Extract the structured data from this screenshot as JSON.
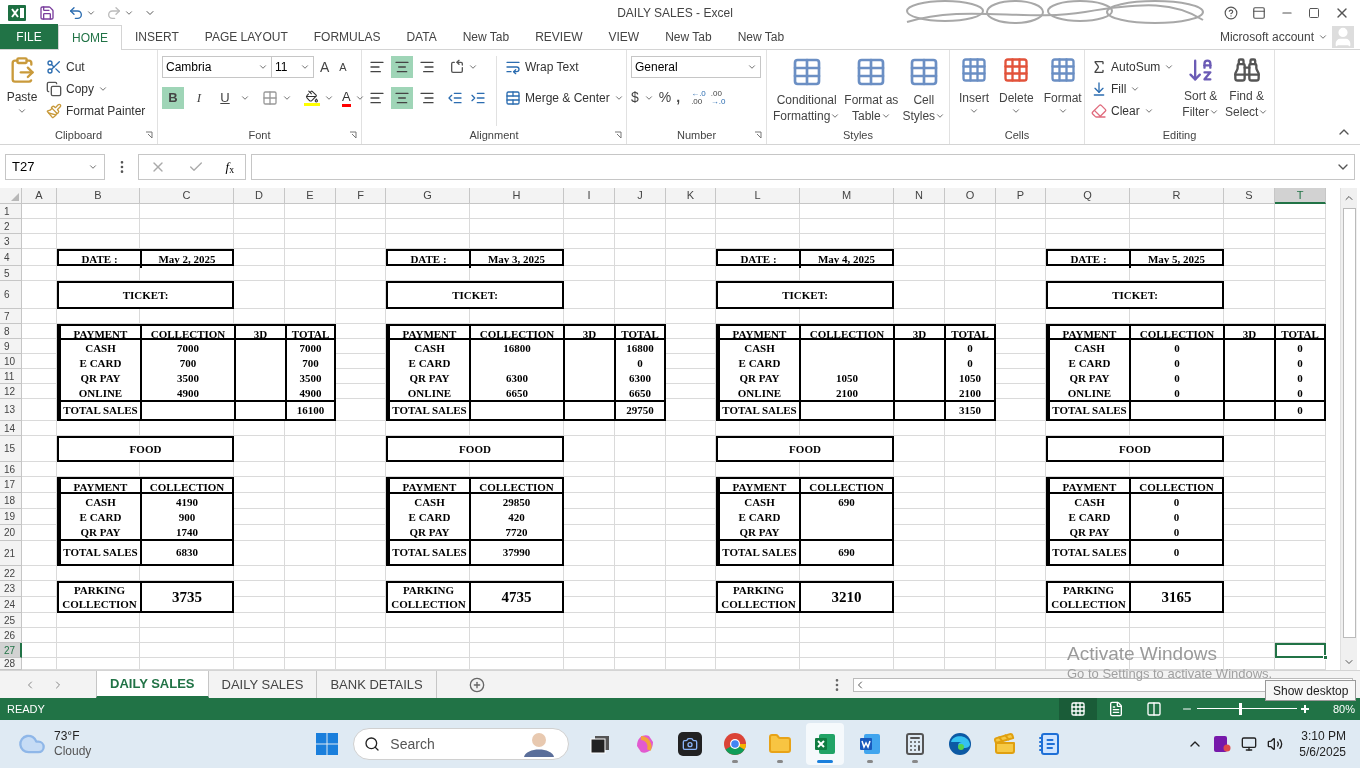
{
  "window": {
    "title": "DAILY SALES - Excel"
  },
  "ribbon_tabs": [
    {
      "label": "FILE",
      "kind": "file",
      "selected": false
    },
    {
      "label": "HOME",
      "kind": "tab",
      "selected": true
    },
    {
      "label": "INSERT",
      "kind": "tab",
      "selected": false
    },
    {
      "label": "PAGE LAYOUT",
      "kind": "tab",
      "selected": false
    },
    {
      "label": "FORMULAS",
      "kind": "tab",
      "selected": false
    },
    {
      "label": "DATA",
      "kind": "tab",
      "selected": false
    },
    {
      "label": "New Tab",
      "kind": "tab",
      "selected": false
    },
    {
      "label": "REVIEW",
      "kind": "tab",
      "selected": false
    },
    {
      "label": "VIEW",
      "kind": "tab",
      "selected": false
    },
    {
      "label": "New Tab",
      "kind": "tab",
      "selected": false
    },
    {
      "label": "New Tab",
      "kind": "tab",
      "selected": false
    }
  ],
  "account": "Microsoft account",
  "clipboard": {
    "paste": "Paste",
    "cut": "Cut",
    "copy": "Copy",
    "format_painter": "Format Painter",
    "label": "Clipboard"
  },
  "font": {
    "name": "Cambria",
    "size": "11",
    "grow": "A",
    "shrink": "A",
    "color_letter": "A",
    "label": "Font",
    "styles": [
      {
        "label": "B",
        "kind": "bold",
        "on": true
      },
      {
        "label": "I",
        "kind": "italic",
        "on": false
      },
      {
        "label": "U",
        "kind": "underline",
        "on": false
      }
    ]
  },
  "alignment": {
    "label": "Alignment",
    "wrap_text": "Wrap Text",
    "merge_center": "Merge & Center",
    "vertical": [
      {
        "kind": "top",
        "selected": false
      },
      {
        "kind": "middle",
        "selected": true
      },
      {
        "kind": "bottom",
        "selected": false
      }
    ],
    "horizontal": [
      {
        "kind": "left",
        "selected": false
      },
      {
        "kind": "center",
        "selected": true
      },
      {
        "kind": "right",
        "selected": false
      }
    ]
  },
  "number": {
    "format": "General",
    "currency": "$",
    "percent": "%",
    "comma": ",",
    "increase_decimal": [
      "←.0",
      ".00"
    ],
    "decrease_decimal": [
      ".00",
      "→.0"
    ],
    "label": "Number"
  },
  "styles": {
    "label": "Styles",
    "buttons": [
      [
        "Conditional",
        "Formatting"
      ],
      [
        "Format as",
        "Table"
      ],
      [
        "Cell",
        "Styles"
      ]
    ]
  },
  "cells": {
    "label": "Cells",
    "buttons": [
      "Insert",
      "Delete",
      "Format"
    ]
  },
  "editing": {
    "label": "Editing",
    "autosum": "AutoSum",
    "fill": "Fill",
    "clear": "Clear",
    "sort": [
      "Sort &",
      "Filter"
    ],
    "find": [
      "Find &",
      "Select"
    ]
  },
  "formula_bar": {
    "name_box": "T27",
    "function_label": "*f*$_{x}$"
  },
  "columns": [
    {
      "label": "A",
      "selected": false
    },
    {
      "label": "B",
      "selected": false
    },
    {
      "label": "C",
      "selected": false
    },
    {
      "label": "D",
      "selected": false
    },
    {
      "label": "E",
      "selected": false
    },
    {
      "label": "F",
      "selected": false
    },
    {
      "label": "G",
      "selected": false
    },
    {
      "label": "H",
      "selected": false
    },
    {
      "label": "I",
      "selected": false
    },
    {
      "label": "J",
      "selected": false
    },
    {
      "label": "K",
      "selected": false
    },
    {
      "label": "L",
      "selected": false
    },
    {
      "label": "M",
      "selected": false
    },
    {
      "label": "N",
      "selected": false
    },
    {
      "label": "O",
      "selected": false
    },
    {
      "label": "P",
      "selected": false
    },
    {
      "label": "Q",
      "selected": false
    },
    {
      "label": "R",
      "selected": false
    },
    {
      "label": "S",
      "selected": false
    },
    {
      "label": "T",
      "selected": true
    }
  ],
  "rows": [
    {
      "label": "1",
      "selected": false
    },
    {
      "label": "2",
      "selected": false
    },
    {
      "label": "3",
      "selected": false
    },
    {
      "label": "4",
      "selected": false
    },
    {
      "label": "5",
      "selected": false
    },
    {
      "label": "6",
      "selected": false
    },
    {
      "label": "7",
      "selected": false
    },
    {
      "label": "8",
      "selected": false
    },
    {
      "label": "9",
      "selected": false
    },
    {
      "label": "10",
      "selected": false
    },
    {
      "label": "11",
      "selected": false
    },
    {
      "label": "12",
      "selected": false
    },
    {
      "label": "13",
      "selected": false
    },
    {
      "label": "14",
      "selected": false
    },
    {
      "label": "15",
      "selected": false
    },
    {
      "label": "16",
      "selected": false
    },
    {
      "label": "17",
      "selected": false
    },
    {
      "label": "18",
      "selected": false
    },
    {
      "label": "19",
      "selected": false
    },
    {
      "label": "20",
      "selected": false
    },
    {
      "label": "21",
      "selected": false
    },
    {
      "label": "22",
      "selected": false
    },
    {
      "label": "23",
      "selected": false
    },
    {
      "label": "24",
      "selected": false
    },
    {
      "label": "25",
      "selected": false
    },
    {
      "label": "26",
      "selected": false
    },
    {
      "label": "27",
      "selected": true
    },
    {
      "label": "28",
      "selected": false
    }
  ],
  "blocks": [
    {
      "date_label": "DATE :",
      "date": "May 2, 2025",
      "ticket": "TICKET:",
      "ticket_columns": [
        "PAYMENT",
        "COLLECTION",
        "3D",
        "TOTAL"
      ],
      "ticket_rows": [
        {
          "payment": "CASH",
          "collection": "7000",
          "total": "7000"
        },
        {
          "payment": "E CARD",
          "collection": "700",
          "total": "700"
        },
        {
          "payment": "QR PAY",
          "collection": "3500",
          "total": "3500"
        },
        {
          "payment": "ONLINE",
          "collection": "4900",
          "total": "4900"
        }
      ],
      "ticket_total_label": "TOTAL SALES",
      "ticket_total": "16100",
      "food": "FOOD",
      "food_columns": [
        "PAYMENT",
        "COLLECTION"
      ],
      "food_rows": [
        {
          "payment": "CASH",
          "collection": "4190"
        },
        {
          "payment": "E CARD",
          "collection": "900"
        },
        {
          "payment": "QR PAY",
          "collection": "1740"
        }
      ],
      "food_total_label": "TOTAL SALES",
      "food_total": "6830",
      "parking_label": [
        "PARKING",
        "COLLECTION"
      ],
      "parking": "3735"
    },
    {
      "date_label": "DATE :",
      "date": "May 3, 2025",
      "ticket": "TICKET:",
      "ticket_columns": [
        "PAYMENT",
        "COLLECTION",
        "3D",
        "TOTAL"
      ],
      "ticket_rows": [
        {
          "payment": "CASH",
          "collection": "16800",
          "total": "16800"
        },
        {
          "payment": "E CARD",
          "total": "0"
        },
        {
          "payment": "QR PAY",
          "collection": "6300",
          "total": "6300"
        },
        {
          "payment": "ONLINE",
          "collection": "6650",
          "total": "6650"
        }
      ],
      "ticket_total_label": "TOTAL SALES",
      "ticket_total": "29750",
      "food": "FOOD",
      "food_columns": [
        "PAYMENT",
        "COLLECTION"
      ],
      "food_rows": [
        {
          "payment": "CASH",
          "collection": "29850"
        },
        {
          "payment": "E CARD",
          "collection": "420"
        },
        {
          "payment": "QR PAY",
          "collection": "7720"
        }
      ],
      "food_total_label": "TOTAL SALES",
      "food_total": "37990",
      "parking_label": [
        "PARKING",
        "COLLECTION"
      ],
      "parking": "4735"
    },
    {
      "date_label": "DATE :",
      "date": "May 4, 2025",
      "ticket": "TICKET:",
      "ticket_columns": [
        "PAYMENT",
        "COLLECTION",
        "3D",
        "TOTAL"
      ],
      "ticket_rows": [
        {
          "payment": "CASH",
          "total": "0"
        },
        {
          "payment": "E CARD",
          "total": "0"
        },
        {
          "payment": "QR PAY",
          "collection": "1050",
          "total": "1050"
        },
        {
          "payment": "ONLINE",
          "collection": "2100",
          "total": "2100"
        }
      ],
      "ticket_total_label": "TOTAL SALES",
      "ticket_total": "3150",
      "food": "FOOD",
      "food_columns": [
        "PAYMENT",
        "COLLECTION"
      ],
      "food_rows": [
        {
          "payment": "CASH",
          "collection": "690"
        },
        {
          "payment": "E CARD"
        },
        {
          "payment": "QR PAY"
        }
      ],
      "food_total_label": "TOTAL SALES",
      "food_total": "690",
      "parking_label": [
        "PARKING",
        "COLLECTION"
      ],
      "parking": "3210"
    },
    {
      "date_label": "DATE :",
      "date": "May 5, 2025",
      "ticket": "TICKET:",
      "ticket_columns": [
        "PAYMENT",
        "COLLECTION",
        "3D",
        "TOTAL"
      ],
      "ticket_rows": [
        {
          "payment": "CASH",
          "collection": "0",
          "total": "0"
        },
        {
          "payment": "E CARD",
          "collection": "0",
          "total": "0"
        },
        {
          "payment": "QR PAY",
          "collection": "0",
          "total": "0"
        },
        {
          "payment": "ONLINE",
          "collection": "0",
          "total": "0"
        }
      ],
      "ticket_total_label": "TOTAL SALES",
      "ticket_total": "0",
      "food": "FOOD",
      "food_columns": [
        "PAYMENT",
        "COLLECTION"
      ],
      "food_rows": [
        {
          "payment": "CASH",
          "collection": "0"
        },
        {
          "payment": "E CARD",
          "collection": "0"
        },
        {
          "payment": "QR PAY",
          "collection": "0"
        }
      ],
      "food_total_label": "TOTAL SALES",
      "food_total": "0",
      "parking_label": [
        "PARKING",
        "COLLECTION"
      ],
      "parking": "3165"
    }
  ],
  "activation": {
    "title": "Activate Windows",
    "text": "Go to Settings to activate Windows."
  },
  "sheet_tabs": [
    {
      "label": "DAILY SALES",
      "selected": true
    },
    {
      "label": "DAILY SALES",
      "selected": false
    },
    {
      "label": "BANK DETAILS",
      "selected": false
    }
  ],
  "status_bar": {
    "text": "READY",
    "views": [
      {
        "kind": "normal",
        "selected": true
      },
      {
        "kind": "page_layout",
        "selected": false
      },
      {
        "kind": "page_break",
        "selected": false
      }
    ],
    "zoom": {
      "level": 0.43
    },
    "zoom_text": "80%"
  },
  "tooltip": "Show desktop",
  "taskbar": {
    "temperature": "73°F",
    "condition": "Cloudy",
    "search_placeholder": "Search",
    "apps": [
      {
        "kind": "task_view",
        "running": false,
        "active": false
      },
      {
        "kind": "copilot",
        "running": false,
        "active": false
      },
      {
        "kind": "camera",
        "running": false,
        "active": false
      },
      {
        "kind": "chrome",
        "running": true,
        "active": false
      },
      {
        "kind": "files",
        "running": true,
        "active": false
      },
      {
        "kind": "excel",
        "running": true,
        "active": true
      },
      {
        "kind": "word",
        "running": true,
        "active": false
      },
      {
        "kind": "calculator",
        "running": true,
        "active": false
      },
      {
        "kind": "edge",
        "running": false,
        "active": false
      },
      {
        "kind": "clapper",
        "running": false,
        "active": false
      },
      {
        "kind": "notepad",
        "running": false,
        "active": false
      }
    ],
    "time": "3:10 PM",
    "date": "5/6/2025"
  }
}
